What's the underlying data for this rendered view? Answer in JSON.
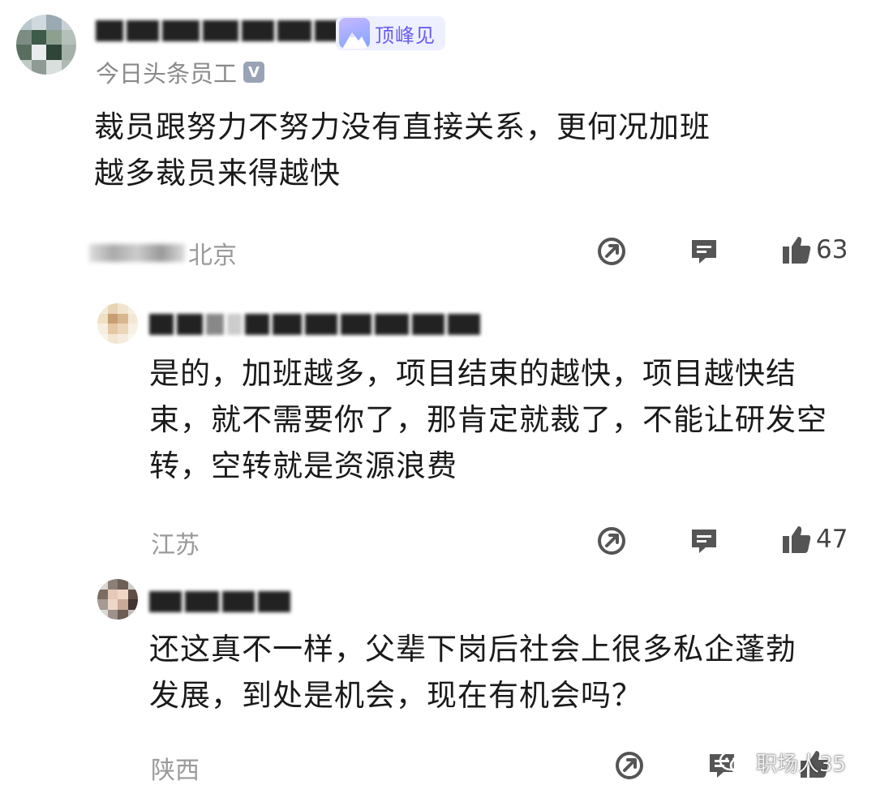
{
  "comments": [
    {
      "badge_label": "顶峰见",
      "author_title": "今日头条员工",
      "verified_mark": "V",
      "lines": [
        "裁员跟努力不努力没有直接关系，更何况加班",
        "越多裁员来得越快"
      ],
      "location": "北京",
      "likes": "63"
    },
    {
      "lines": [
        "是的，加班越多，项目结束的越快，项目越快结",
        "束，就不需要你了，那肯定就裁了，不能让研发空",
        "转，空转就是资源浪费"
      ],
      "location": "江苏",
      "likes": "47"
    },
    {
      "lines": [
        "还这真不一样，父辈下岗后社会上很多私企蓬勃",
        "发展，到处是机会，现在有机会吗？"
      ],
      "location": "陕西"
    }
  ],
  "watermark": {
    "text": "职场人35"
  },
  "icons": {
    "share": "share-arrow-icon",
    "reply": "comment-bubble-icon",
    "like": "thumbs-up-icon",
    "wechat": "wechat-icon"
  }
}
